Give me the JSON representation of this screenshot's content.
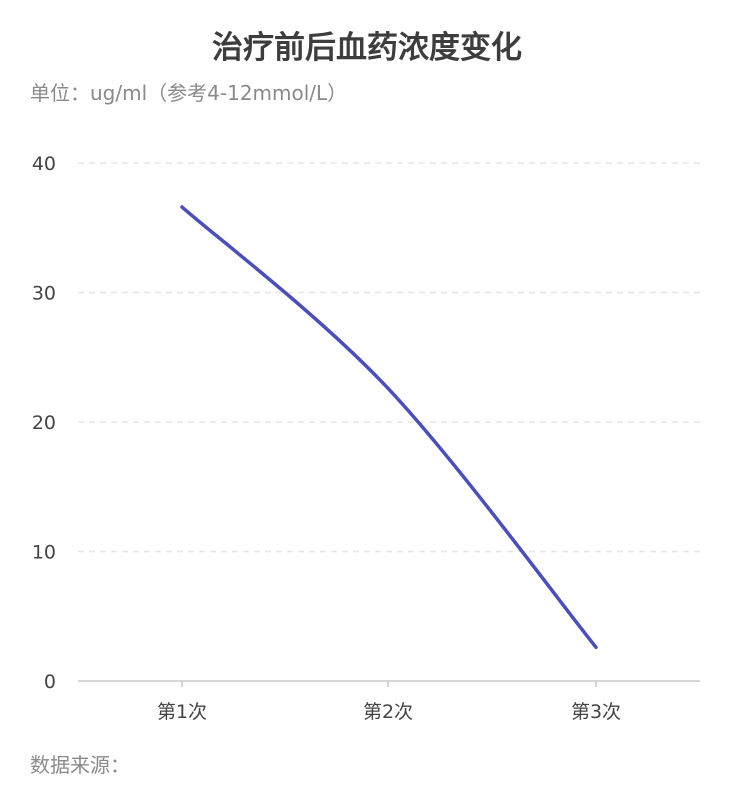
{
  "chart_data": {
    "type": "line",
    "title": "治疗前后血药浓度变化",
    "subtitle": "单位：ug/ml（参考4-12mmol/L）",
    "categories": [
      "第1次",
      "第2次",
      "第3次"
    ],
    "series": [
      {
        "values": [
          36.6,
          22.6,
          2.6
        ],
        "color": "#4a50b5"
      }
    ],
    "ylim": [
      0,
      40
    ],
    "yticks": [
      0,
      10,
      20,
      30,
      40
    ],
    "grid": true,
    "smooth": true
  },
  "footer": "数据来源："
}
